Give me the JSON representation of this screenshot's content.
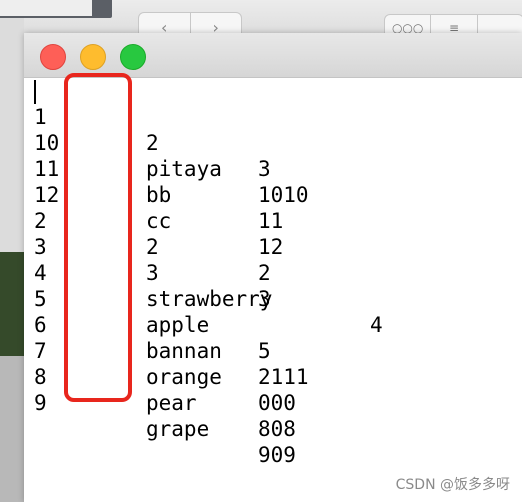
{
  "window": {
    "controls": {
      "close": "close",
      "minimize": "minimize",
      "maximize": "zoom"
    }
  },
  "background": {
    "nav_back_icon": "chevron-left-icon",
    "nav_forward_icon": "chevron-right-icon",
    "view_grid_icon": "grid-icon",
    "view_list_icon": "list-icon"
  },
  "rows": [
    {
      "c1": "1",
      "c2": "2",
      "c3": "3"
    },
    {
      "c1": "10",
      "c2": "pitaya",
      "c3": "1010"
    },
    {
      "c1": "11",
      "c2": "bb",
      "c3": "11"
    },
    {
      "c1": "12",
      "c2": "cc",
      "c3": "12"
    },
    {
      "c1": "2",
      "c2": "2",
      "c3": "2"
    },
    {
      "c1": "3",
      "c2": "3",
      "c3": "3"
    },
    {
      "c1": "4",
      "c2": "strawberry",
      "c3": "4"
    },
    {
      "c1": "5",
      "c2": "apple",
      "c3": "5"
    },
    {
      "c1": "6",
      "c2": "bannan",
      "c3": "2111"
    },
    {
      "c1": "7",
      "c2": "orange",
      "c3": "000"
    },
    {
      "c1": "8",
      "c2": "pear",
      "c3": "808"
    },
    {
      "c1": "9",
      "c2": "grape",
      "c3": "909"
    }
  ],
  "watermark": "CSDN @饭多多呀",
  "colors": {
    "annotation": "#e8261d",
    "close": "#fe5f57",
    "minimize": "#febc2e",
    "maximize": "#28c840"
  }
}
